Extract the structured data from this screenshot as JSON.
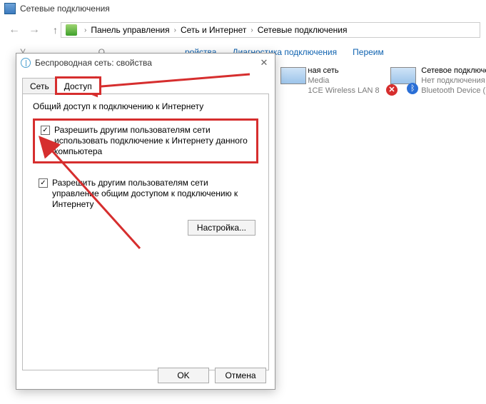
{
  "explorer_window_title": "Сетевые подключения",
  "breadcrumb": {
    "level1": "Панель управления",
    "level2": "Сеть и Интернет",
    "level3": "Сетевые подключения"
  },
  "toolbar": {
    "organize": "У",
    "disable": "О",
    "rename": "ройства",
    "diagnose": "Диагностика подключения",
    "rename2": "Переим"
  },
  "devices": {
    "wifi": {
      "name_suffix": "ная сеть",
      "line2": "Media",
      "line3": "1CE Wireless LAN 802..."
    },
    "bt": {
      "name": "Сетевое подключен",
      "line2": "Нет подключения",
      "line3": "Bluetooth Device (P"
    }
  },
  "dialog": {
    "title": "Беспроводная сеть: свойства",
    "tabs": {
      "network": "Сеть",
      "sharing": "Доступ"
    },
    "group_label": "Общий доступ к подключению к Интернету",
    "chk1": "Разрешить другим пользователям сети использовать подключение к Интернету данного компьютера",
    "chk2": "Разрешить другим пользователям сети управление общим доступом к подключению к Интернету",
    "settings_btn": "Настройка...",
    "ok": "OK",
    "cancel": "Отмена"
  }
}
